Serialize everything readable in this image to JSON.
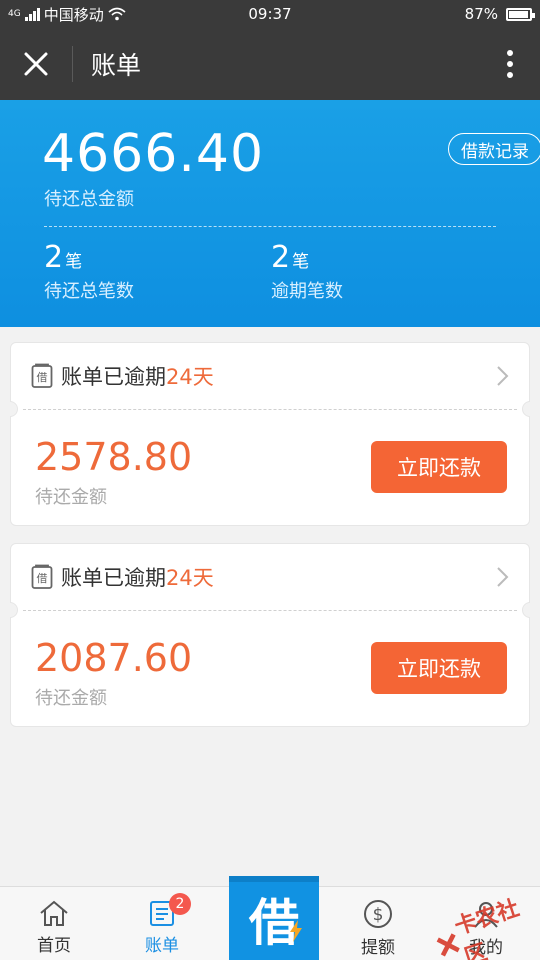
{
  "status_bar": {
    "network_tag": "4G",
    "carrier": "中国移动",
    "time": "09:37",
    "battery": "87%"
  },
  "nav": {
    "title": "账单"
  },
  "summary": {
    "total_amount": "4666.40",
    "total_label": "待还总金额",
    "record_button": "借款记录",
    "stats": [
      {
        "num": "2",
        "unit": "笔",
        "label": "待还总笔数"
      },
      {
        "num": "2",
        "unit": "笔",
        "label": "逾期笔数"
      }
    ]
  },
  "bills": [
    {
      "status_prefix": "账单已逾期",
      "days": "24天",
      "amount": "2578.80",
      "amount_label": "待还金额",
      "pay_button": "立即还款",
      "icon_char": "借"
    },
    {
      "status_prefix": "账单已逾期",
      "days": "24天",
      "amount": "2087.60",
      "amount_label": "待还金额",
      "pay_button": "立即还款",
      "icon_char": "借"
    }
  ],
  "tabs": {
    "home": "首页",
    "bills": "账单",
    "bills_badge": "2",
    "borrow": "借",
    "withdraw": "提额",
    "mine": "我的"
  },
  "watermark": "卡农社区",
  "colors": {
    "accent_blue": "#1192e2",
    "accent_orange": "#f46535"
  }
}
